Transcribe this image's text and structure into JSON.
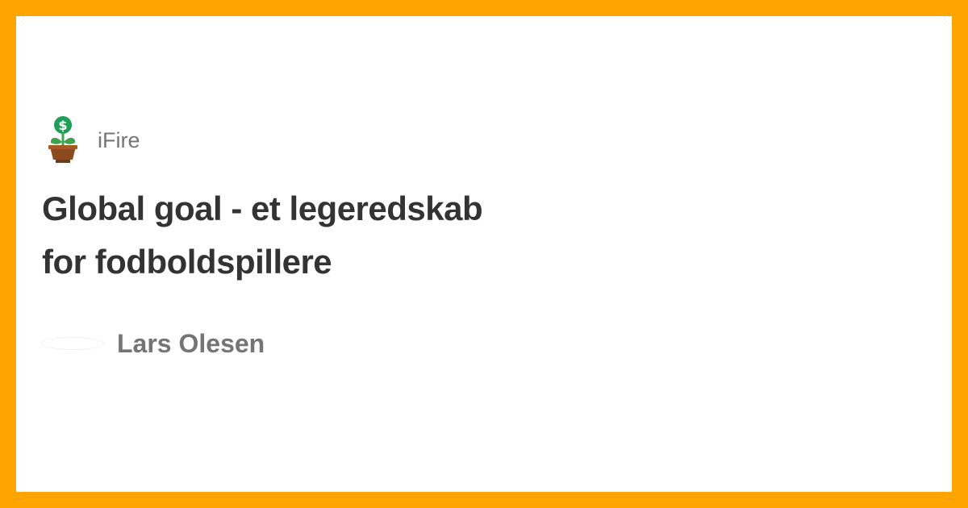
{
  "publication": {
    "name": "iFire",
    "logo_icon": "money-plant-icon"
  },
  "article": {
    "title": "Global goal - et legeredskab for fodboldspillere"
  },
  "author": {
    "name": "Lars Olesen"
  },
  "colors": {
    "frame": "#FFA500",
    "card": "#FFFFFF",
    "title_text": "#333333",
    "meta_text": "#757575",
    "coin": "#1E9E57",
    "leaf": "#3FA34D",
    "pot": "#8B4A1F"
  }
}
